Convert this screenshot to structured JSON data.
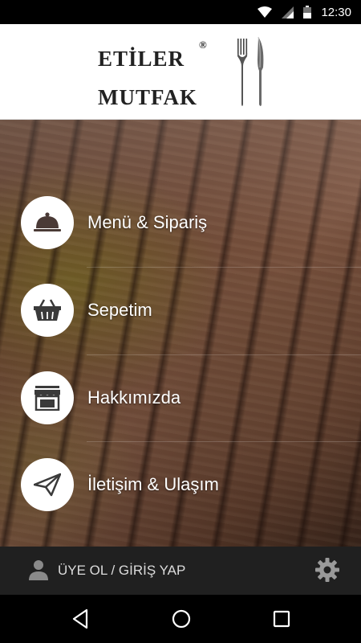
{
  "status_bar": {
    "time": "12:30"
  },
  "header": {
    "logo_line1": "ETİLER",
    "logo_line2": "MUTFAK",
    "logo_mark": "®"
  },
  "menu": {
    "items": [
      {
        "label": "Menü & Sipariş",
        "icon": "cloche-icon"
      },
      {
        "label": "Sepetim",
        "icon": "basket-icon"
      },
      {
        "label": "Hakkımızda",
        "icon": "storefront-icon"
      },
      {
        "label": "İletişim & Ulaşım",
        "icon": "paper-plane-icon"
      }
    ]
  },
  "bottom_bar": {
    "login_label": "ÜYE OL / GİRİŞ YAP",
    "user_icon": "user-icon",
    "settings_icon": "gear-icon"
  },
  "colors": {
    "header_bg": "#ffffff",
    "bottom_bar_bg": "#202020",
    "icon_color": "#3a3a3a",
    "text_on_hero": "#ffffff"
  }
}
